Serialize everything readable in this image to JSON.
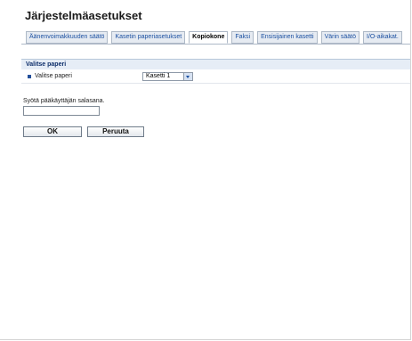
{
  "page_title": "Järjestelmäasetukset",
  "tabs": [
    {
      "label": "Äänenvoimakkuuden säätö",
      "active": false
    },
    {
      "label": "Kasetin paperiasetukset",
      "active": false
    },
    {
      "label": "Kopiokone",
      "active": true
    },
    {
      "label": "Faksi",
      "active": false
    },
    {
      "label": "Ensisijainen kasetti",
      "active": false
    },
    {
      "label": "Värin säätö",
      "active": false
    },
    {
      "label": "I/O-aikakat.",
      "active": false
    }
  ],
  "section": {
    "title": "Valitse paperi",
    "row_label": "Valitse paperi",
    "select_value": "Kasetti 1"
  },
  "password": {
    "label": "Syötä pääkäyttäjän salasana.",
    "value": ""
  },
  "buttons": {
    "ok": "OK",
    "cancel": "Peruuta"
  },
  "colors": {
    "tab_text": "#1a4fa0",
    "section_bg": "#e6edf6",
    "section_text": "#0e2f6b"
  }
}
